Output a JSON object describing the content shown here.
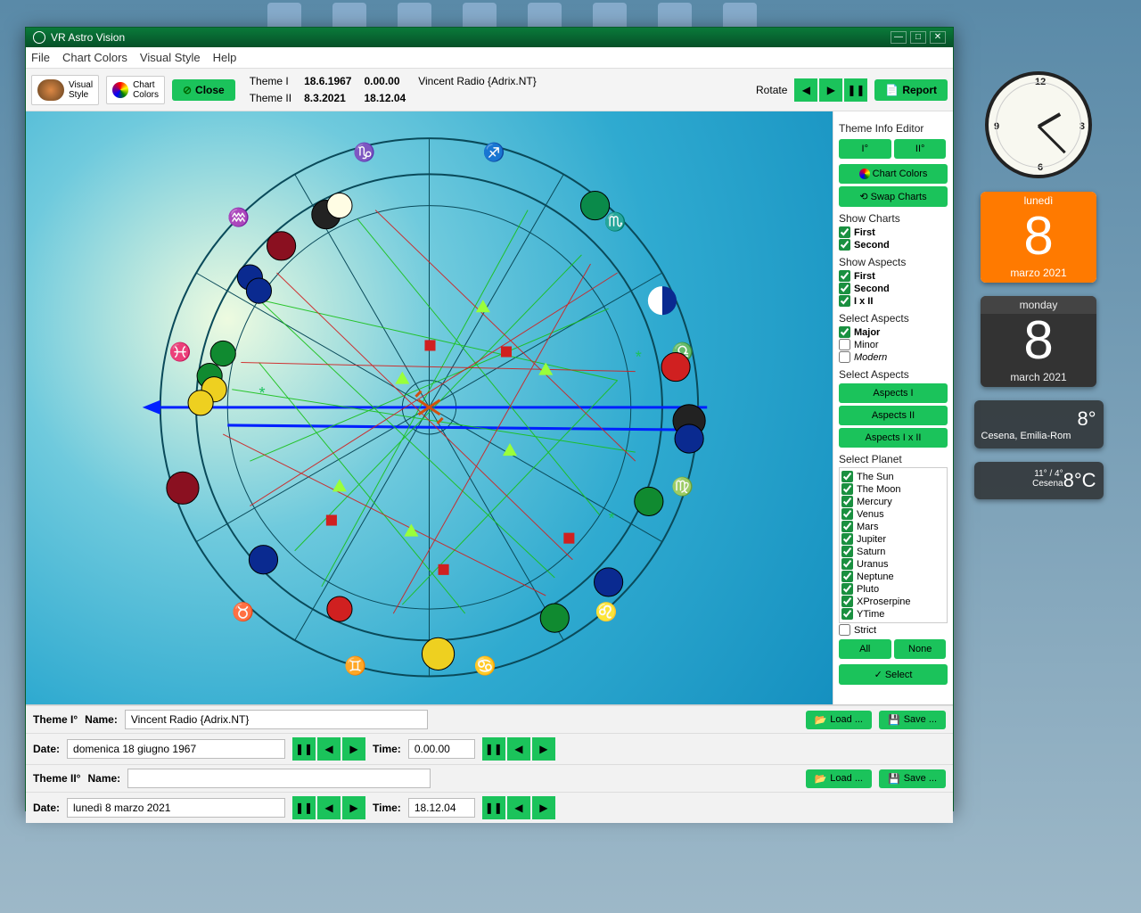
{
  "window_title": "VR Astro Vision",
  "menubar": [
    "File",
    "Chart Colors",
    "Visual Style",
    "Help"
  ],
  "toolbar": {
    "visual_style": "Visual\nStyle",
    "chart_colors": "Chart\nColors",
    "close": "Close",
    "rotate": "Rotate",
    "report": "Report"
  },
  "theme_info": {
    "t1_label": "Theme I",
    "t1_date": "18.6.1967",
    "t1_time": "0.00.00",
    "t1_name": "Vincent Radio {Adrix.NT}",
    "t2_label": "Theme II",
    "t2_date": "8.3.2021",
    "t2_time": "18.12.04"
  },
  "side": {
    "editor_title": "Theme Info Editor",
    "btn_i": "I°",
    "btn_ii": "II°",
    "chart_colors": "Chart Colors",
    "swap": "Swap Charts",
    "show_charts": "Show Charts",
    "first": "First",
    "second": "Second",
    "show_aspects": "Show Aspects",
    "ixii": "I x II",
    "select_aspects": "Select Aspects",
    "major": "Major",
    "minor": "Minor",
    "modern": "Modern",
    "select_aspects2": "Select Aspects",
    "aspects_i": "Aspects I",
    "aspects_ii": "Aspects II",
    "aspects_ixii": "Aspects I x II",
    "select_planet": "Select Planet",
    "planets": [
      "The Sun",
      "The Moon",
      "Mercury",
      "Venus",
      "Mars",
      "Jupiter",
      "Saturn",
      "Uranus",
      "Neptune",
      "Pluto",
      "XProserpine",
      "YTime"
    ],
    "strict": "Strict",
    "all": "All",
    "none": "None",
    "select": "Select"
  },
  "bottom": {
    "theme_i": "Theme I°",
    "theme_ii": "Theme II°",
    "name_lbl": "Name:",
    "date_lbl": "Date:",
    "time_lbl": "Time:",
    "name_i": "Vincent Radio {Adrix.NT}",
    "date_i": "domenica 18 giugno 1967",
    "time_i": "0.00.00",
    "name_ii": "",
    "date_ii": "lunedì 8 marzo 2021",
    "time_ii": "18.12.04",
    "load": "Load ...",
    "save": "Save ..."
  },
  "widgets": {
    "cal1_head": "lunedì",
    "cal1_day": "8",
    "cal1_foot": "marzo 2021",
    "cal2_head": "monday",
    "cal2_day": "8",
    "cal2_foot": "march 2021",
    "w1_temp": "8°",
    "w1_loc": "Cesena, Emilia-Rom",
    "w2_temp": "8°C",
    "w2_range": "11° / 4°",
    "w2_loc": "Cesena"
  }
}
